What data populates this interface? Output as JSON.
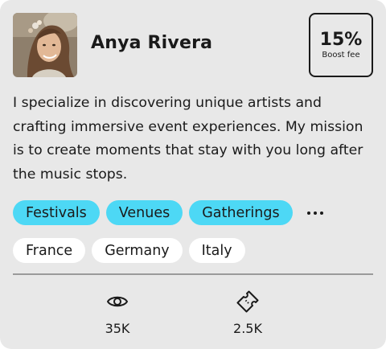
{
  "profile": {
    "name": "Anya Rivera",
    "avatar_icon": "profile-photo"
  },
  "boost": {
    "percent": "15%",
    "label": "Boost fee"
  },
  "bio": "I specialize in discovering unique artists and crafting immersive event experiences. My mission is to create moments that stay with you long after the music stops.",
  "categories": [
    {
      "label": "Festivals",
      "color": "#4dd8f5"
    },
    {
      "label": "Venues",
      "color": "#4dd8f5"
    },
    {
      "label": "Gatherings",
      "color": "#4dd8f5"
    }
  ],
  "more_icon": "ellipsis-icon",
  "locations": [
    {
      "label": "France"
    },
    {
      "label": "Germany"
    },
    {
      "label": "Italy"
    }
  ],
  "stats": {
    "views": {
      "value": "35K",
      "icon": "eye-icon"
    },
    "tickets": {
      "value": "2.5K",
      "icon": "ticket-icon"
    }
  },
  "colors": {
    "card_background": "#e8e8e8",
    "tag_accent": "#4dd8f5",
    "text": "#1a1a1a"
  }
}
